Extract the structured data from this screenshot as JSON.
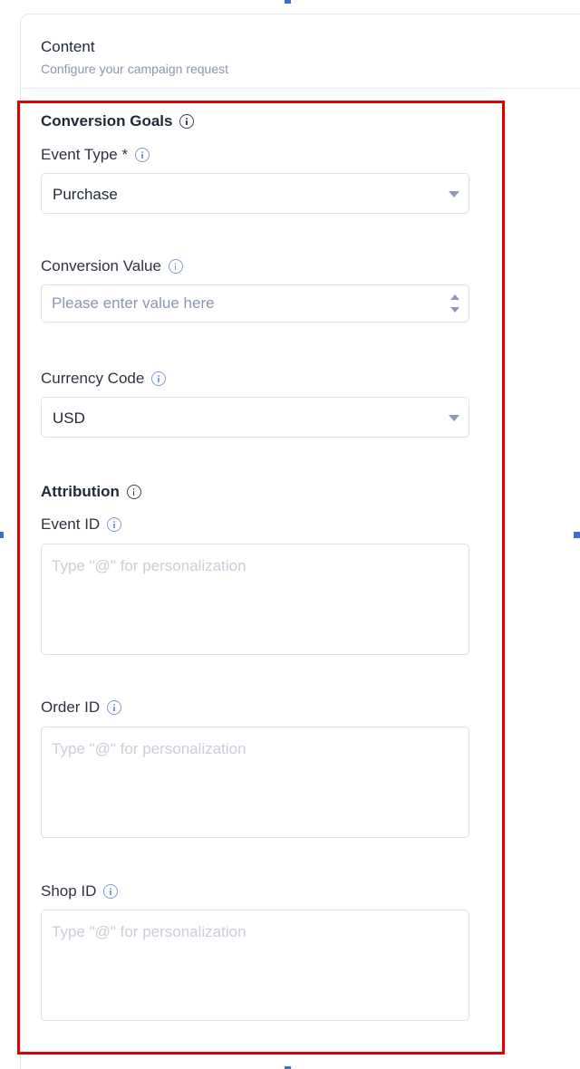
{
  "header": {
    "title": "Content",
    "subtitle": "Configure your campaign request"
  },
  "conversion_goals": {
    "title": "Conversion Goals",
    "event_type": {
      "label": "Event Type *",
      "value": "Purchase"
    },
    "conversion_value": {
      "label": "Conversion Value",
      "placeholder": "Please enter value here"
    },
    "currency_code": {
      "label": "Currency Code",
      "value": "USD"
    }
  },
  "attribution": {
    "title": "Attribution",
    "event_id": {
      "label": "Event ID",
      "placeholder": "Type \"@\" for personalization"
    },
    "order_id": {
      "label": "Order ID",
      "placeholder": "Type \"@\" for personalization"
    },
    "shop_id": {
      "label": "Shop ID",
      "placeholder": "Type \"@\" for personalization"
    }
  },
  "colors": {
    "highlight_border": "#e00000",
    "info_icon": "#7f9bd4",
    "subtitle": "#8a96b2",
    "selection_handle": "#3b6fd4"
  }
}
